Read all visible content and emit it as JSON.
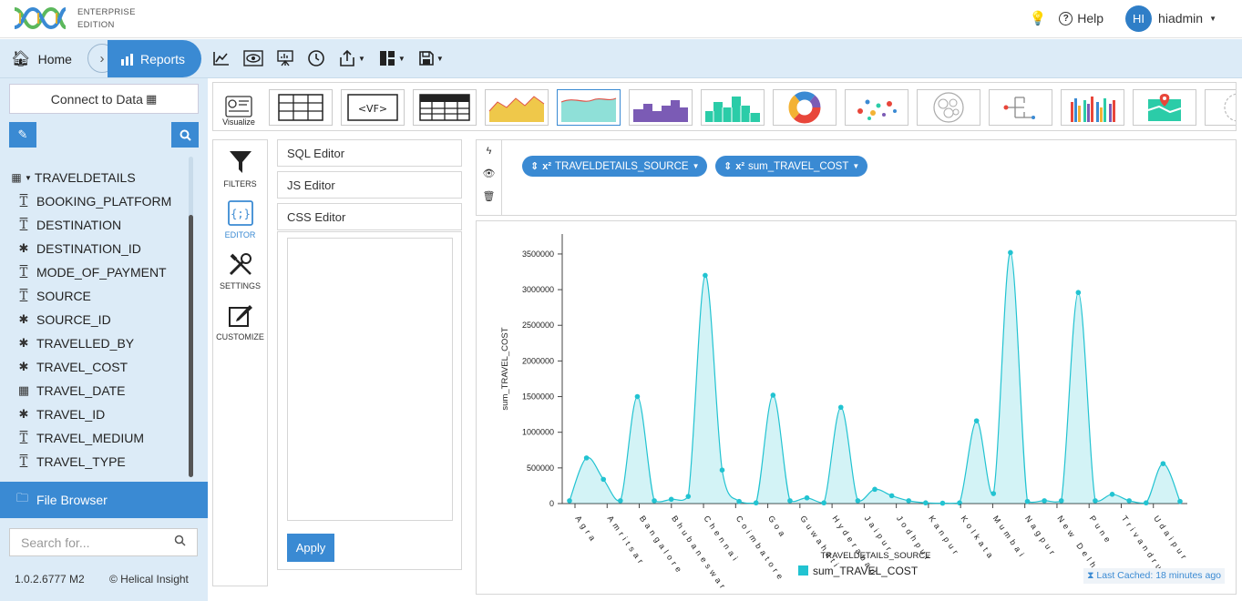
{
  "header": {
    "edition_line1": "ENTERPRISE",
    "edition_line2": "EDITION",
    "help_label": "Help",
    "avatar_initials": "HI",
    "username": "hiadmin"
  },
  "nav": {
    "home_label": "Home",
    "reports_label": "Reports",
    "tools": [
      "line-chart-icon",
      "preview-icon",
      "presentation-icon",
      "history-icon",
      "export-icon",
      "layout-icon",
      "save-icon"
    ]
  },
  "sidebar": {
    "connect_label": "Connect to Data",
    "table_name": "TRAVELDETAILS",
    "fields": [
      {
        "name": "BOOKING_PLATFORM",
        "type": "text"
      },
      {
        "name": "DESTINATION",
        "type": "text"
      },
      {
        "name": "DESTINATION_ID",
        "type": "number"
      },
      {
        "name": "MODE_OF_PAYMENT",
        "type": "text"
      },
      {
        "name": "SOURCE",
        "type": "text"
      },
      {
        "name": "SOURCE_ID",
        "type": "number"
      },
      {
        "name": "TRAVELLED_BY",
        "type": "number"
      },
      {
        "name": "TRAVEL_COST",
        "type": "number"
      },
      {
        "name": "TRAVEL_DATE",
        "type": "date"
      },
      {
        "name": "TRAVEL_ID",
        "type": "number"
      },
      {
        "name": "TRAVEL_MEDIUM",
        "type": "text"
      },
      {
        "name": "TRAVEL_TYPE",
        "type": "text"
      }
    ],
    "file_browser_label": "File Browser",
    "search_placeholder": "Search for...",
    "version": "1.0.2.6777 M2",
    "copyright": "© Helical Insight"
  },
  "palette": {
    "visualize_label": "Visualize"
  },
  "tools": {
    "filters": "FILTERS",
    "editor": "EDITOR",
    "settings": "SETTINGS",
    "customize": "CUSTOMIZE"
  },
  "editor": {
    "sql": "SQL Editor",
    "js": "JS Editor",
    "css": "CSS Editor",
    "apply": "Apply"
  },
  "shelf": {
    "pill1": "TRAVELDETAILS_SOURCE",
    "pill2": "sum_TRAVEL_COST",
    "pill_prefix": "x²"
  },
  "cache_label": "Last Cached: 18 minutes ago",
  "colors": {
    "accent": "#3a8ad3",
    "series": "#22c3d1"
  },
  "chart_data": {
    "type": "area",
    "xlabel": "TRAVELDETAILS_SOURCE",
    "ylabel": "sum_TRAVEL_COST",
    "ylim": [
      0,
      3500000
    ],
    "yticks": [
      0,
      500000,
      1000000,
      1500000,
      2000000,
      2500000,
      3000000,
      3500000
    ],
    "x": [
      "Agra",
      "Amritsar",
      "Bangalore",
      "Bhubaneswar",
      "Chennai",
      "Coimbatore",
      "Goa",
      "Guwahati",
      "Hyderabad",
      "Jaipur",
      "Jodhpur",
      "Kanpur",
      "Kolkata",
      "Mumbai",
      "Nagpur",
      "New Delhi",
      "Pune",
      "Trivandrum",
      "Udaipur"
    ],
    "series": [
      {
        "name": "sum_TRAVEL_COST",
        "values": [
          40000,
          640000,
          340000,
          40000,
          1500000,
          40000,
          60000,
          100000,
          3200000,
          470000,
          30000,
          10000,
          1520000,
          40000,
          80000,
          10000,
          1350000,
          40000,
          200000,
          110000,
          40000,
          10000,
          5000,
          10000,
          1160000,
          140000,
          3520000,
          30000,
          40000,
          40000,
          2960000,
          40000,
          130000,
          40000,
          10000,
          560000,
          30000
        ]
      }
    ]
  }
}
